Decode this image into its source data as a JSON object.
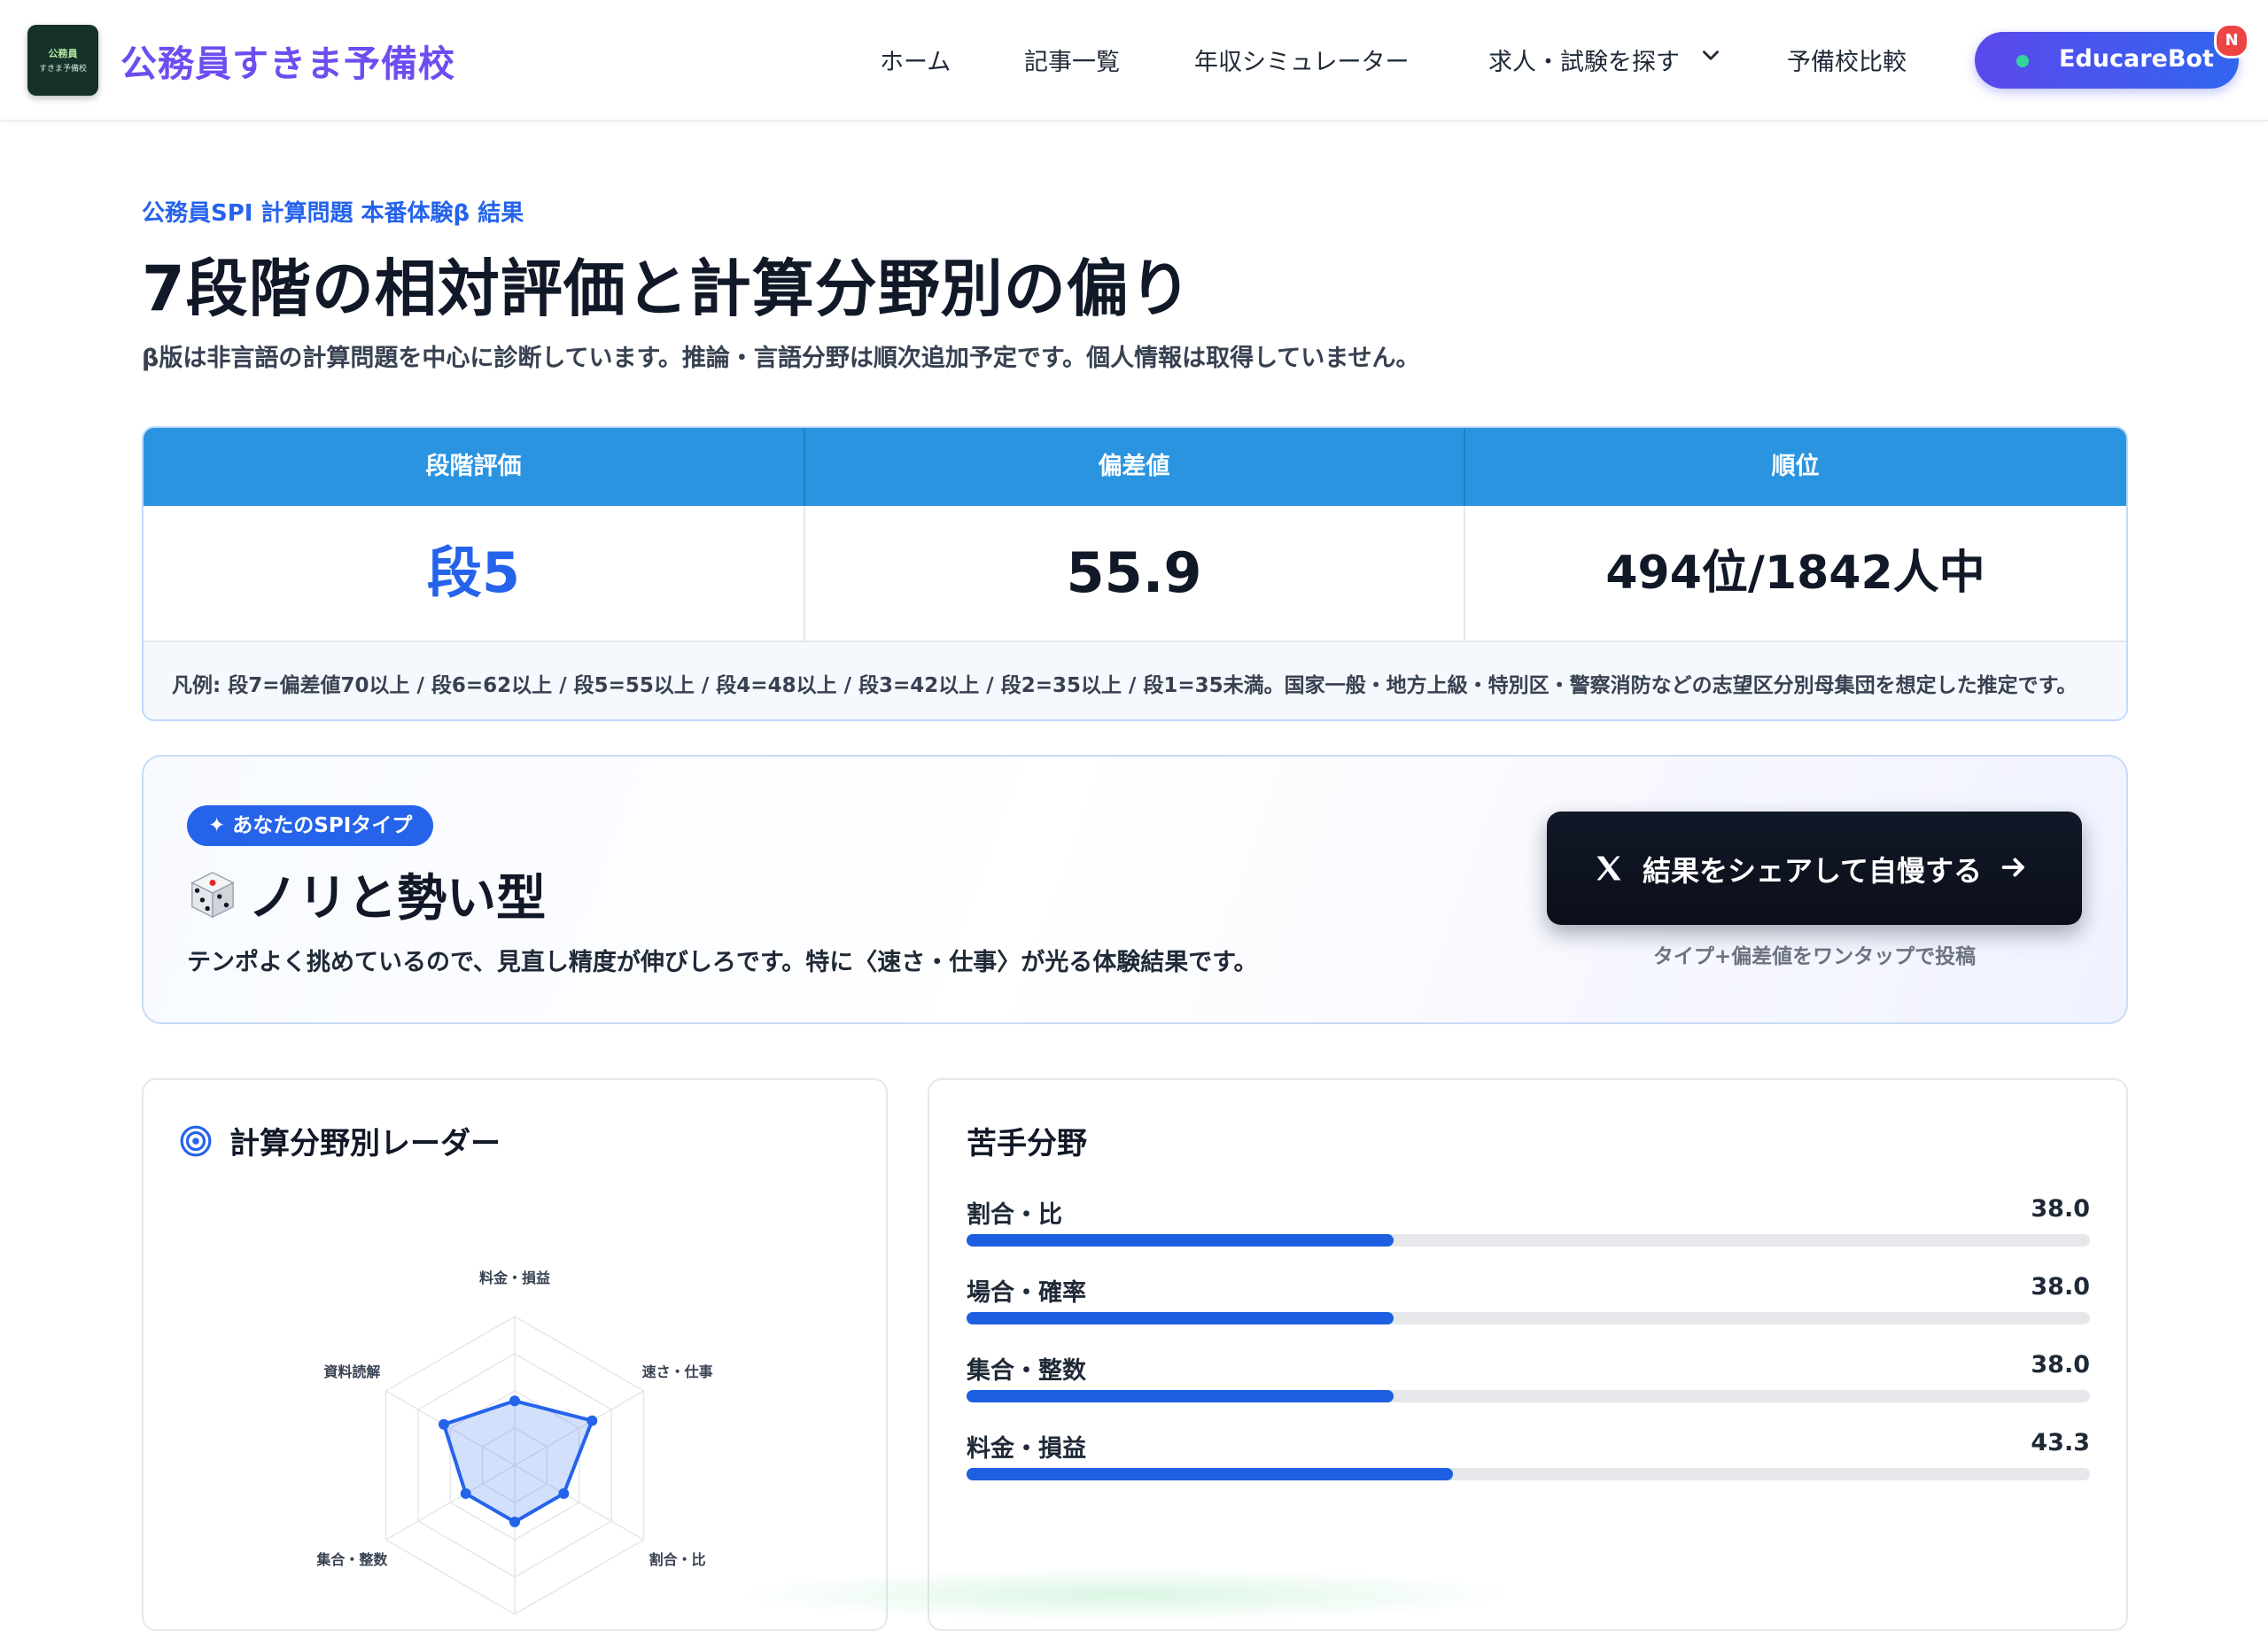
{
  "header": {
    "logo_line1": "公務員",
    "logo_line2": "すきま予備校",
    "brand": "公務員すきま予備校",
    "nav": [
      {
        "label": "ホーム"
      },
      {
        "label": "記事一覧"
      },
      {
        "label": "年収シミュレーター"
      },
      {
        "label": "求人・試験を探す"
      },
      {
        "label": "予備校比較"
      }
    ],
    "bot_label": "EducareBot",
    "bot_badge": "N"
  },
  "hero": {
    "eyebrow": "公務員SPI 計算問題 本番体験β 結果",
    "title": "7段階の相対評価と計算分野別の偏り",
    "lead": "β版は非言語の計算問題を中心に診断しています。推論・言語分野は順次追加予定です。個人情報は取得していません。"
  },
  "results": {
    "headers": [
      "段階評価",
      "偏差値",
      "順位"
    ],
    "stage": "段5",
    "deviation": "55.9",
    "rank": "494位/1842人中",
    "legend": "凡例: 段7=偏差値70以上 / 段6=62以上 / 段5=55以上 / 段4=48以上 / 段3=42以上 / 段2=35以上 / 段1=35未満。国家一般・地方上級・特別区・警察消防などの志望区分別母集団を想定した推定です。"
  },
  "type_card": {
    "pill": "✦ あなたのSPIタイプ",
    "icon": "dice-icon",
    "name": "ノリと勢い型",
    "description": "テンポよく挑めているので、見直し精度が伸びしろです。特に〈速さ・仕事〉が光る体験結果です。",
    "share_label": "結果をシェアして自慢する",
    "share_note": "タイプ+偏差値をワンタップで投稿"
  },
  "radar": {
    "title": "計算分野別レーダー",
    "icon": "target-icon",
    "accent": "#2563eb",
    "axes": [
      {
        "label": "料金・損益",
        "score": 43.3
      },
      {
        "label": "速さ・仕事",
        "score": 60
      },
      {
        "label": "割合・比",
        "score": 38.0
      },
      {
        "label": "場合・確率",
        "score": 38.0
      },
      {
        "label": "集合・整数",
        "score": 38.0
      },
      {
        "label": "資料読解",
        "score": 55
      }
    ],
    "max": 100
  },
  "weak": {
    "title": "苦手分野",
    "max": 100,
    "items": [
      {
        "label": "割合・比",
        "score": "38.0",
        "value": 38.0
      },
      {
        "label": "場合・確率",
        "score": "38.0",
        "value": 38.0
      },
      {
        "label": "集合・整数",
        "score": "38.0",
        "value": 38.0
      },
      {
        "label": "料金・損益",
        "score": "43.3",
        "value": 43.3
      }
    ]
  }
}
